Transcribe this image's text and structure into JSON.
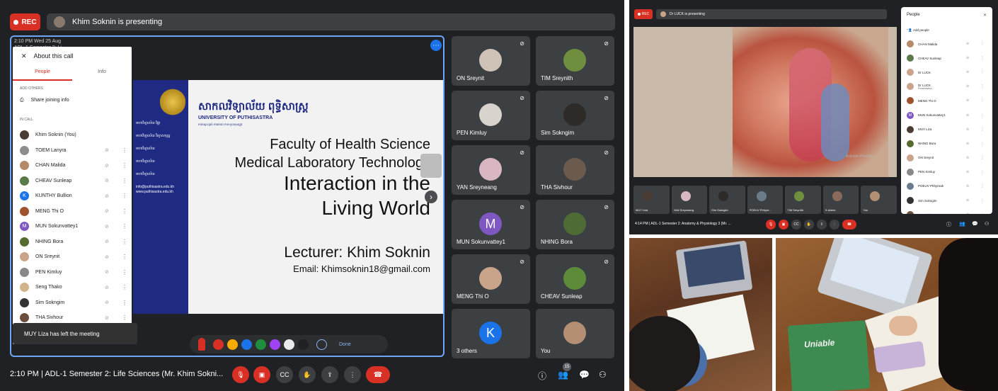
{
  "meet": {
    "rec_label": "REC",
    "presenting": "Khim Soknin is presenting",
    "stage_caption_time": "2:10 PM  Wed 25 Aug",
    "stage_caption_title": "ADL-1 Semester 2: Li...",
    "panel": {
      "title": "About this call",
      "tabs": [
        "People",
        "Info"
      ],
      "add_others": "ADD OTHERS",
      "share": "Share joining info",
      "in_call": "IN CALL",
      "people": [
        {
          "name": "Khim Soknin (You)",
          "color": "#4a3b33"
        },
        {
          "name": "TOEM Lanyra",
          "color": "#8d8d8d"
        },
        {
          "name": "CHAN Malida",
          "color": "#b58a6b"
        },
        {
          "name": "CHEAV Sunleap",
          "color": "#5b7a4a"
        },
        {
          "name": "KUNTHY Bullion",
          "color": "#1a73e8",
          "letter": "K"
        },
        {
          "name": "MENG Thi O",
          "color": "#a0522d"
        },
        {
          "name": "MUN Sokunvattey1",
          "color": "#7e57c2",
          "letter": "M"
        },
        {
          "name": "NHING Bora",
          "color": "#556b2f"
        },
        {
          "name": "ON Sreynit",
          "color": "#c9a38a"
        },
        {
          "name": "PEN Kimluy",
          "color": "#888"
        },
        {
          "name": "Seng Thako",
          "color": "#d2b48c"
        },
        {
          "name": "Sim Sokngim",
          "color": "#333"
        },
        {
          "name": "THA Sivhour",
          "color": "#6b4e3d"
        },
        {
          "name": "TIM Sreynith",
          "color": "#7a9a4a"
        },
        {
          "name": "YAN Sreyneang",
          "color": "#c08aa0"
        }
      ],
      "toast": "MUY Liza has left the meeting"
    },
    "slide": {
      "university_km": "សាកលវិទ្យាល័យ ពុទ្ធិសាស្ត្រ",
      "university_en": "UNIVERSITY OF PUTHISASTRA",
      "sub": "ភាពស្មោះត្រង់   ការគោរព   ការទទួលខុសត្រូវ",
      "sidebar": [
        "មហាវិទ្យាល័យ វិជ្ជា",
        "មហាវិទ្យាល័យ វិទ្យាសាស្ត្រ",
        "មហាវិទ្យាល័យ",
        "មហាវិទ្យាល័យ",
        "មហាវិទ្យាល័យ",
        "info@puthisastra.edu.kh www.puthisastra.edu.kh"
      ],
      "line1": "Faculty of Health Science",
      "line2": "Medical Laboratory Technology",
      "line3": "Interaction in the",
      "line4": "Living World",
      "lecturer": "Lecturer: Khim Soknin",
      "email": "Email: Khimsoknin18@gmail.com"
    },
    "draw_done": "Done",
    "swatches": [
      "#d93025",
      "#f9ab00",
      "#1a73e8",
      "#1e8e3e",
      "#a142f4",
      "#e8eaed",
      "#202124"
    ],
    "tiles": [
      {
        "name": "ON Sreynit",
        "color": "#cfc3b8"
      },
      {
        "name": "TIM Sreynith",
        "color": "#6f8f3f"
      },
      {
        "name": "PEN Kimluy",
        "color": "#d9d3cd"
      },
      {
        "name": "Sim Sokngim",
        "color": "#2e2a28"
      },
      {
        "name": "YAN Sreyneang",
        "color": "#d8b7c3"
      },
      {
        "name": "THA Sivhour",
        "color": "#6c5b4c"
      },
      {
        "name": "MUN Sokunvattey1",
        "color": "#7e57c2",
        "letter": "M"
      },
      {
        "name": "NHING Bora",
        "color": "#4f6b35"
      },
      {
        "name": "MENG Thi O",
        "color": "#c9a38a"
      },
      {
        "name": "CHEAV Sunleap",
        "color": "#5d8b3a"
      },
      {
        "name": "3 others",
        "color": "#1a73e8",
        "letter": "K"
      },
      {
        "name": "You",
        "color": "#b58f73"
      }
    ],
    "bottom": {
      "time_title": "2:10 PM  |  ADL-1 Semester 2: Life Sciences (Mr. Khim Sokni...",
      "people_count": "15"
    }
  },
  "meet2": {
    "rec_label": "REC",
    "presenting": "Dr LUCK is presenting",
    "watermark": "Activate Windows",
    "strip": [
      "MUY Liza",
      "YAN Sreyneang",
      "Sim Sokngim",
      "POEUV Phhyre...",
      "TIM Sreynith",
      "9 others",
      "You"
    ],
    "bottom_title": "4:14 PM  |  ADL-1 Semester 2: Anatomy & Physiology 3 (Mr. ...",
    "people_title": "People",
    "add_people": "Add people",
    "people": [
      {
        "name": "CHAN Malida",
        "color": "#b58a6b"
      },
      {
        "name": "CHEAV Sunleap",
        "color": "#5b7a4a"
      },
      {
        "name": "Dr LUCK",
        "color": "#c9a38a"
      },
      {
        "name": "Dr LUCK",
        "sub": "Presentation",
        "color": "#c9a38a"
      },
      {
        "name": "MENG Thi O",
        "color": "#a0522d"
      },
      {
        "name": "MUN Sokunvattey1",
        "color": "#7e57c2",
        "letter": "M"
      },
      {
        "name": "MUY Liza",
        "color": "#4a3b33"
      },
      {
        "name": "NHING Bora",
        "color": "#556b2f"
      },
      {
        "name": "ON Sreynit",
        "color": "#c9a38a"
      },
      {
        "name": "PEN Kimluy",
        "color": "#888"
      },
      {
        "name": "POEUV Phhyreak",
        "color": "#6b7b8a"
      },
      {
        "name": "Sim Sokngim",
        "color": "#333"
      },
      {
        "name": "THA Sivhour",
        "color": "#6b4e3d"
      }
    ]
  },
  "photo2_book_label": "Uniable"
}
